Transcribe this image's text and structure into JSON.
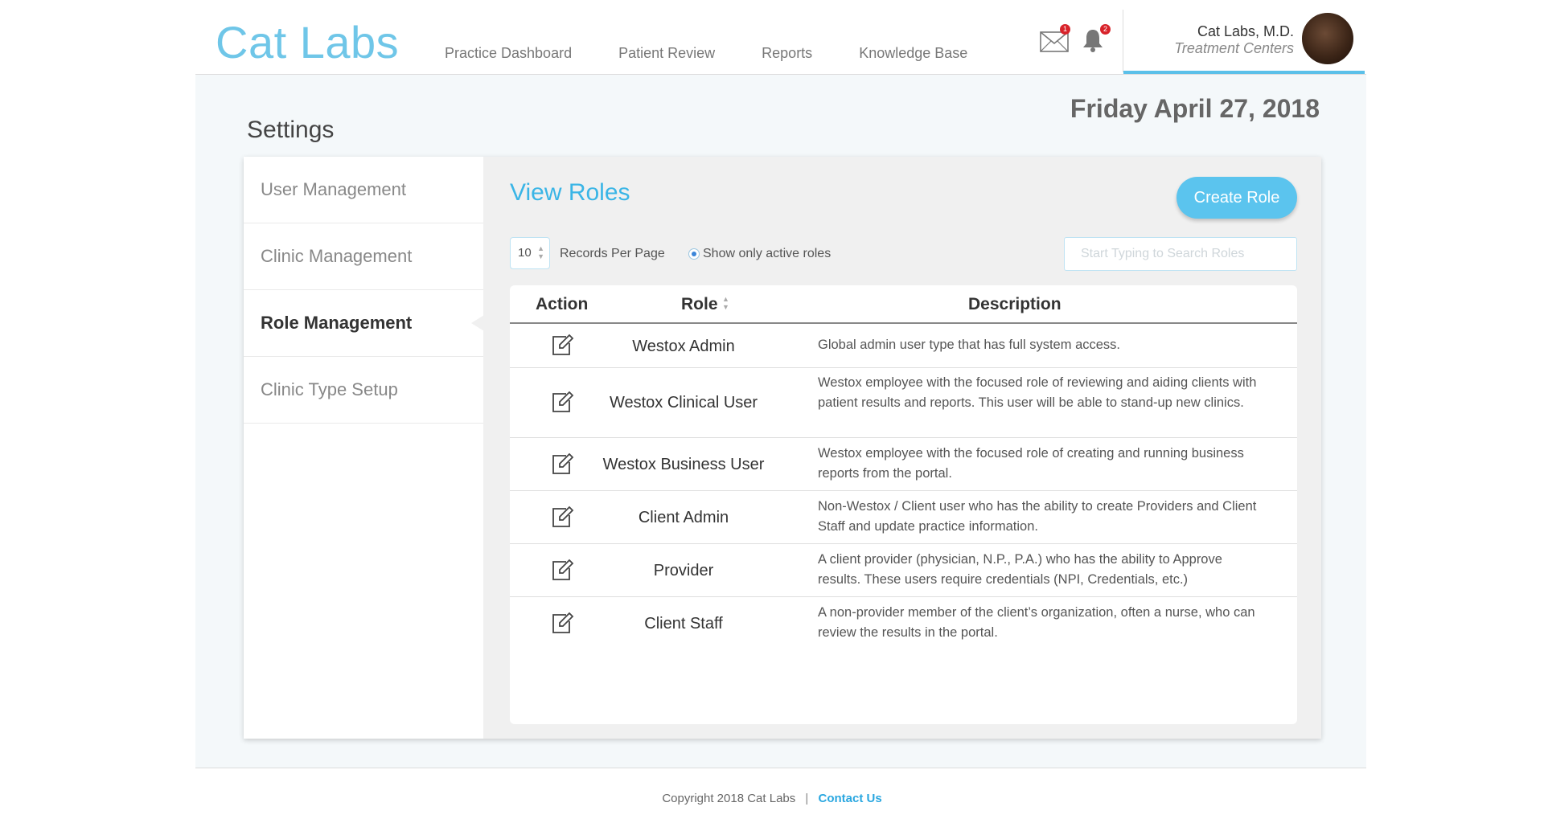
{
  "app": {
    "logo": "Cat Labs"
  },
  "nav": [
    {
      "label": "Practice Dashboard"
    },
    {
      "label": "Patient Review"
    },
    {
      "label": "Reports"
    },
    {
      "label": "Knowledge Base"
    }
  ],
  "notifications": {
    "mail_count": "1",
    "bell_count": "2",
    "mail_icon": "mail-icon",
    "bell_icon": "bell-icon"
  },
  "user": {
    "name": "Cat Labs, M.D.",
    "subtitle": "Treatment Centers"
  },
  "page": {
    "title": "Settings",
    "date": "Friday April 27, 2018"
  },
  "sidebar": {
    "items": [
      {
        "label": "User Management",
        "active": false
      },
      {
        "label": "Clinic Management",
        "active": false
      },
      {
        "label": "Role Management",
        "active": true
      },
      {
        "label": "Clinic Type Setup",
        "active": false
      }
    ]
  },
  "main": {
    "title": "View Roles",
    "create_button": "Create Role",
    "records_per_page": "10",
    "records_per_page_label": "Records Per Page",
    "show_active_label": "Show only active roles",
    "search_placeholder": "Start Typing to Search Roles"
  },
  "table": {
    "headers": {
      "action": "Action",
      "role": "Role",
      "description": "Description"
    },
    "rows": [
      {
        "role": "Westox Admin",
        "description": "Global admin user type that has full system access."
      },
      {
        "role": "Westox Clinical User",
        "description": "Westox employee with the focused role of reviewing and aiding clients with patient results and reports.  This user will be able to stand-up new clinics."
      },
      {
        "role": "Westox Business User",
        "description": "Westox employee with the focused role of creating and running business reports from the portal."
      },
      {
        "role": "Client Admin",
        "description": "Non-Westox / Client user who has the ability to create Providers and Client Staff and update practice information."
      },
      {
        "role": "Provider",
        "description": "A client provider (physician, N.P., P.A.) who has the ability to Approve results.  These users require credentials (NPI, Credentials, etc.)"
      },
      {
        "role": "Client Staff",
        "description": "A non-provider member of the client’s organization, often a nurse, who can review the results in the portal."
      }
    ]
  },
  "footer": {
    "copyright": "Copyright 2018 Cat Labs",
    "separator": "|",
    "contact": "Contact Us"
  },
  "colors": {
    "accent": "#5bc4ee",
    "logo": "#6fc6e8",
    "badge": "#d8232a"
  }
}
